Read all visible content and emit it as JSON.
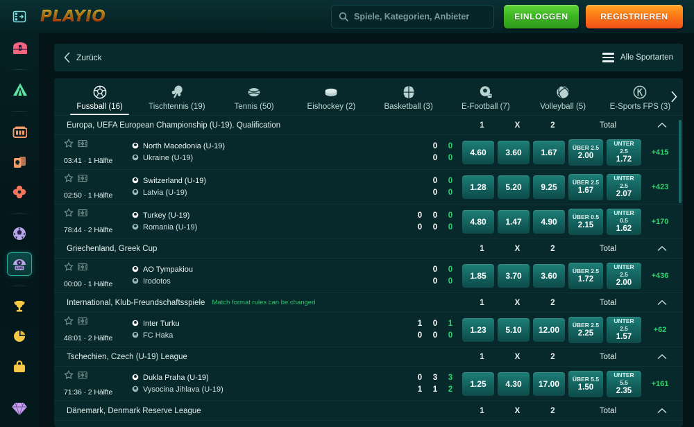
{
  "header": {
    "menu_icon": "panel-toggle-icon",
    "logo_text": "PLAYIO",
    "search": {
      "icon": "search-icon",
      "value": "",
      "placeholder": "Spiele, Kategorien, Anbieter"
    },
    "login_label": "EINLOGGEN",
    "register_label": "REGISTRIEREN",
    "login_color": "#3cb524",
    "register_color": "#fc7a16"
  },
  "sidebar": {
    "items": [
      {
        "name": "treasure-chest-icon",
        "color": "#f4647f",
        "active": false
      },
      {
        "name": "tent-icon",
        "color": "#5fe3a1",
        "active": false
      },
      {
        "name": "slot-machine-icon",
        "color": "#f79a6a",
        "active": false
      },
      {
        "name": "cards-icon",
        "color": "#f79a6a",
        "active": false
      },
      {
        "name": "clover-icon",
        "color": "#f4755b",
        "active": false
      },
      {
        "name": "soccer-ball-icon",
        "color": "#b7a8e8",
        "active": false
      },
      {
        "name": "live-sports-icon",
        "color": "#b7a8e8",
        "active": true,
        "badge": "LIVE"
      },
      {
        "name": "trophy-icon",
        "color": "#f6c846",
        "active": false
      },
      {
        "name": "coin-icon",
        "color": "#f6c846",
        "active": false
      },
      {
        "name": "bag-icon",
        "color": "#f6c846",
        "active": false
      },
      {
        "name": "diamond-icon",
        "color": "#c79df0",
        "active": false
      }
    ]
  },
  "backbar": {
    "back_icon": "chevron-left-icon",
    "back_label": "Zurück",
    "all_sports_icon": "hamburger-icon",
    "all_sports_label": "Alle Sportarten"
  },
  "tabs": {
    "next_icon": "chevron-right-icon",
    "items": [
      {
        "label": "Fussball (16)",
        "icon": "soccer-ball-icon",
        "active": true
      },
      {
        "label": "Tischtennis (19)",
        "icon": "table-tennis-icon",
        "active": false
      },
      {
        "label": "Tennis (50)",
        "icon": "tennis-ball-icon",
        "active": false
      },
      {
        "label": "Eishockey (2)",
        "icon": "hockey-puck-icon",
        "active": false
      },
      {
        "label": "Basketball (3)",
        "icon": "basketball-icon",
        "active": false
      },
      {
        "label": "E-Football (7)",
        "icon": "e-football-icon",
        "active": false
      },
      {
        "label": "Volleyball (5)",
        "icon": "volleyball-icon",
        "active": false
      },
      {
        "label": "E-Sports FPS (3)",
        "icon": "esports-fps-icon",
        "active": false
      }
    ]
  },
  "columns": {
    "c1": "1",
    "cx": "X",
    "c2": "2",
    "total": "Total",
    "collapse_icon": "chevron-up-icon"
  },
  "leagues": [
    {
      "name": "Europa, UEFA European Championship (U-19). Qualification",
      "note": "",
      "matches": [
        {
          "time": "03:41 · 1 Hälfte",
          "home": "North Macedonia (U-19)",
          "away": "Ukraine (U-19)",
          "periods": [],
          "score_home": "0",
          "score_away": "0",
          "total_home": "0",
          "total_away": "0",
          "odd1": "4.60",
          "oddX": "3.60",
          "odd2": "1.67",
          "over_cap": "ÜBER 2.5",
          "over_val": "2.00",
          "under_cap": "UNTER 2.5",
          "under_val": "1.72",
          "more": "+415"
        },
        {
          "time": "02:50 · 1 Hälfte",
          "home": "Switzerland (U-19)",
          "away": "Latvia (U-19)",
          "periods": [],
          "score_home": "0",
          "score_away": "0",
          "total_home": "0",
          "total_away": "0",
          "odd1": "1.28",
          "oddX": "5.20",
          "odd2": "9.25",
          "over_cap": "ÜBER 2.5",
          "over_val": "1.67",
          "under_cap": "UNTER 2.5",
          "under_val": "2.07",
          "more": "+423"
        },
        {
          "time": "78:44 · 2 Hälfte",
          "home": "Turkey (U-19)",
          "away": "Romania (U-19)",
          "periods": [
            [
              "0",
              "0"
            ],
            [
              "0",
              "0"
            ]
          ],
          "score_home": "0",
          "score_away": "0",
          "total_home": "0",
          "total_away": "0",
          "odd1": "4.80",
          "oddX": "1.47",
          "odd2": "4.90",
          "over_cap": "ÜBER 0.5",
          "over_val": "2.15",
          "under_cap": "UNTER 0.5",
          "under_val": "1.62",
          "more": "+170"
        }
      ]
    },
    {
      "name": "Griechenland, Greek Cup",
      "note": "",
      "matches": [
        {
          "time": "00:00 · 1 Hälfte",
          "home": "AO Tympakiou",
          "away": "Irodotos",
          "periods": [],
          "score_home": "0",
          "score_away": "0",
          "total_home": "0",
          "total_away": "0",
          "odd1": "1.85",
          "oddX": "3.70",
          "odd2": "3.60",
          "over_cap": "ÜBER 2.5",
          "over_val": "1.72",
          "under_cap": "UNTER 2.5",
          "under_val": "2.00",
          "more": "+436"
        }
      ]
    },
    {
      "name": "International, Klub-Freundschaftsspiele",
      "note": "Match format rules can be changed",
      "matches": [
        {
          "time": "48:01 · 2 Hälfte",
          "home": "Inter Turku",
          "away": "FC Haka",
          "periods": [
            [
              "1",
              "0"
            ],
            [
              "0",
              "0"
            ]
          ],
          "score_home": "1",
          "score_away": "0",
          "total_home": "1",
          "total_away": "0",
          "odd1": "1.23",
          "oddX": "5.10",
          "odd2": "12.00",
          "over_cap": "ÜBER 2.5",
          "over_val": "2.25",
          "under_cap": "UNTER 2.5",
          "under_val": "1.57",
          "more": "+62"
        }
      ]
    },
    {
      "name": "Tschechien, Czech (U-19) League",
      "note": "",
      "matches": [
        {
          "time": "71:36 · 2 Hälfte",
          "home": "Dukla Praha (U-19)",
          "away": "Vysocina Jihlava (U-19)",
          "periods": [
            [
              "0",
              "1"
            ],
            [
              "3",
              "1"
            ]
          ],
          "score_home": "0",
          "score_away": "1",
          "total_home": "3",
          "total_away": "2",
          "odd1": "1.25",
          "oddX": "4.30",
          "odd2": "17.00",
          "over_cap": "ÜBER 5.5",
          "over_val": "1.50",
          "under_cap": "UNTER 5.5",
          "under_val": "2.35",
          "more": "+161"
        }
      ]
    },
    {
      "name": "Dänemark, Denmark Reserve League",
      "note": "",
      "matches": []
    }
  ],
  "theme": {
    "page_bg": "#041417",
    "panel_bg": "#07292b",
    "accent_teal": "#1e7f78",
    "accent_green": "#2fd36d"
  }
}
